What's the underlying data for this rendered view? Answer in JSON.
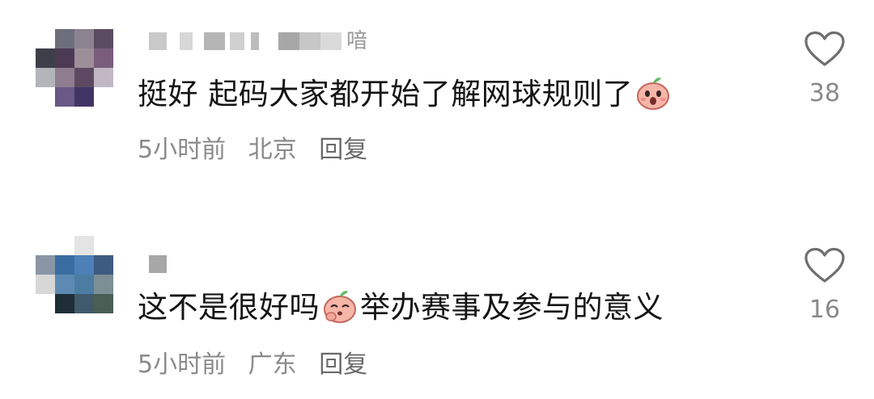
{
  "comments": [
    {
      "username_visible": "喑",
      "content_before_emoji": "挺好 起码大家都开始了解网球规则了",
      "content_after_emoji": "",
      "emoji": "peach-face-emoji",
      "time": "5小时前",
      "location": "北京",
      "reply_label": "回复",
      "likes": "38"
    },
    {
      "username_visible": "",
      "content_before_emoji": "这不是很好吗",
      "content_after_emoji": "举办赛事及参与的意义",
      "emoji": "peach-face-emoji",
      "time": "5小时前",
      "location": "广东",
      "reply_label": "回复",
      "likes": "16"
    }
  ],
  "colors": {
    "meta_text": "#8a8a8a",
    "content_text": "#151515",
    "heart_outline": "#6f6f6f",
    "emoji_peach": "#f6b6a8",
    "emoji_leaf": "#5dbb63"
  }
}
